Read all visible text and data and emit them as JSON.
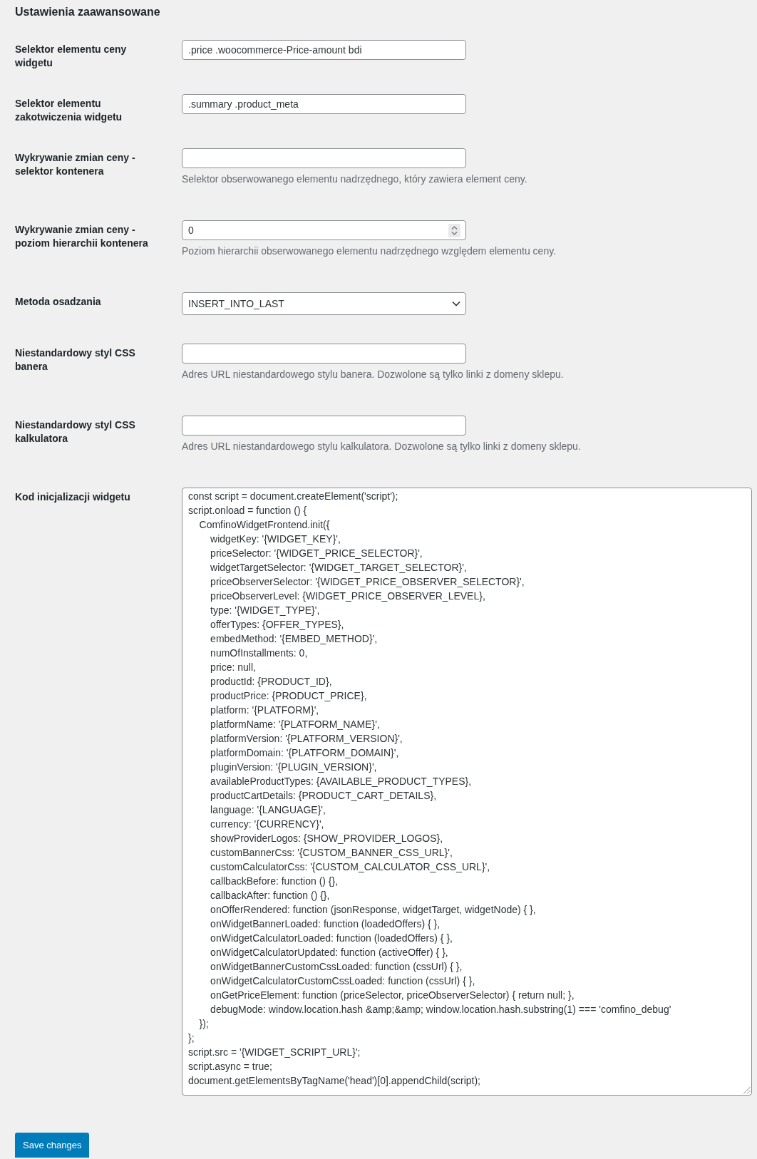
{
  "section": {
    "title": "Ustawienia zaawansowane"
  },
  "fields": [
    {
      "kind": "text",
      "label": "Selektor elementu ceny widgetu",
      "value": ".price .woocommerce-Price-amount bdi"
    },
    {
      "kind": "text",
      "label": "Selektor elementu zakotwiczenia widgetu",
      "value": ".summary .product_meta"
    },
    {
      "kind": "text",
      "label": "Wykrywanie zmian ceny - selektor kontenera",
      "description": "Selektor obserwowanego elementu nadrzędnego, który zawiera element ceny."
    },
    {
      "kind": "number",
      "label": "Wykrywanie zmian ceny - poziom hierarchii kontenera",
      "value": "0",
      "description": "Poziom hierarchii obserwowanego elementu nadrzędnego względem elementu ceny."
    },
    {
      "kind": "select",
      "label": "Metoda osadzania",
      "value": "INSERT_INTO_LAST"
    },
    {
      "kind": "text",
      "label": "Niestandardowy styl CSS banera",
      "description": "Adres URL niestandardowego stylu banera. Dozwolone są tylko linki z domeny sklepu."
    },
    {
      "kind": "text",
      "label": "Niestandardowy styl CSS kalkulatora",
      "description": "Adres URL niestandardowego stylu kalkulatora. Dozwolone są tylko linki z domeny sklepu."
    },
    {
      "kind": "textarea",
      "label": "Kod inicjalizacji widgetu",
      "value": "const script = document.createElement('script');\nscript.onload = function () {\n    ComfinoWidgetFrontend.init({\n        widgetKey: '{WIDGET_KEY}',\n        priceSelector: '{WIDGET_PRICE_SELECTOR}',\n        widgetTargetSelector: '{WIDGET_TARGET_SELECTOR}',\n        priceObserverSelector: '{WIDGET_PRICE_OBSERVER_SELECTOR}',\n        priceObserverLevel: {WIDGET_PRICE_OBSERVER_LEVEL},\n        type: '{WIDGET_TYPE}',\n        offerTypes: {OFFER_TYPES},\n        embedMethod: '{EMBED_METHOD}',\n        numOfInstallments: 0,\n        price: null,\n        productId: {PRODUCT_ID},\n        productPrice: {PRODUCT_PRICE},\n        platform: '{PLATFORM}',\n        platformName: '{PLATFORM_NAME}',\n        platformVersion: '{PLATFORM_VERSION}',\n        platformDomain: '{PLATFORM_DOMAIN}',\n        pluginVersion: '{PLUGIN_VERSION}',\n        availableProductTypes: {AVAILABLE_PRODUCT_TYPES},\n        productCartDetails: {PRODUCT_CART_DETAILS},\n        language: '{LANGUAGE}',\n        currency: '{CURRENCY}',\n        showProviderLogos: {SHOW_PROVIDER_LOGOS},\n        customBannerCss: '{CUSTOM_BANNER_CSS_URL}',\n        customCalculatorCss: '{CUSTOM_CALCULATOR_CSS_URL}',\n        callbackBefore: function () {},\n        callbackAfter: function () {},\n        onOfferRendered: function (jsonResponse, widgetTarget, widgetNode) { },\n        onWidgetBannerLoaded: function (loadedOffers) { },\n        onWidgetCalculatorLoaded: function (loadedOffers) { },\n        onWidgetCalculatorUpdated: function (activeOffer) { },\n        onWidgetBannerCustomCssLoaded: function (cssUrl) { },\n        onWidgetCalculatorCustomCssLoaded: function (cssUrl) { },\n        onGetPriceElement: function (priceSelector, priceObserverSelector) { return null; },\n        debugMode: window.location.hash &amp;&amp; window.location.hash.substring(1) === 'comfino_debug'\n    });\n};\nscript.src = '{WIDGET_SCRIPT_URL}';\nscript.async = true;\ndocument.getElementsByTagName('head')[0].appendChild(script);"
    }
  ],
  "save_button": {
    "label": "Save changes"
  }
}
